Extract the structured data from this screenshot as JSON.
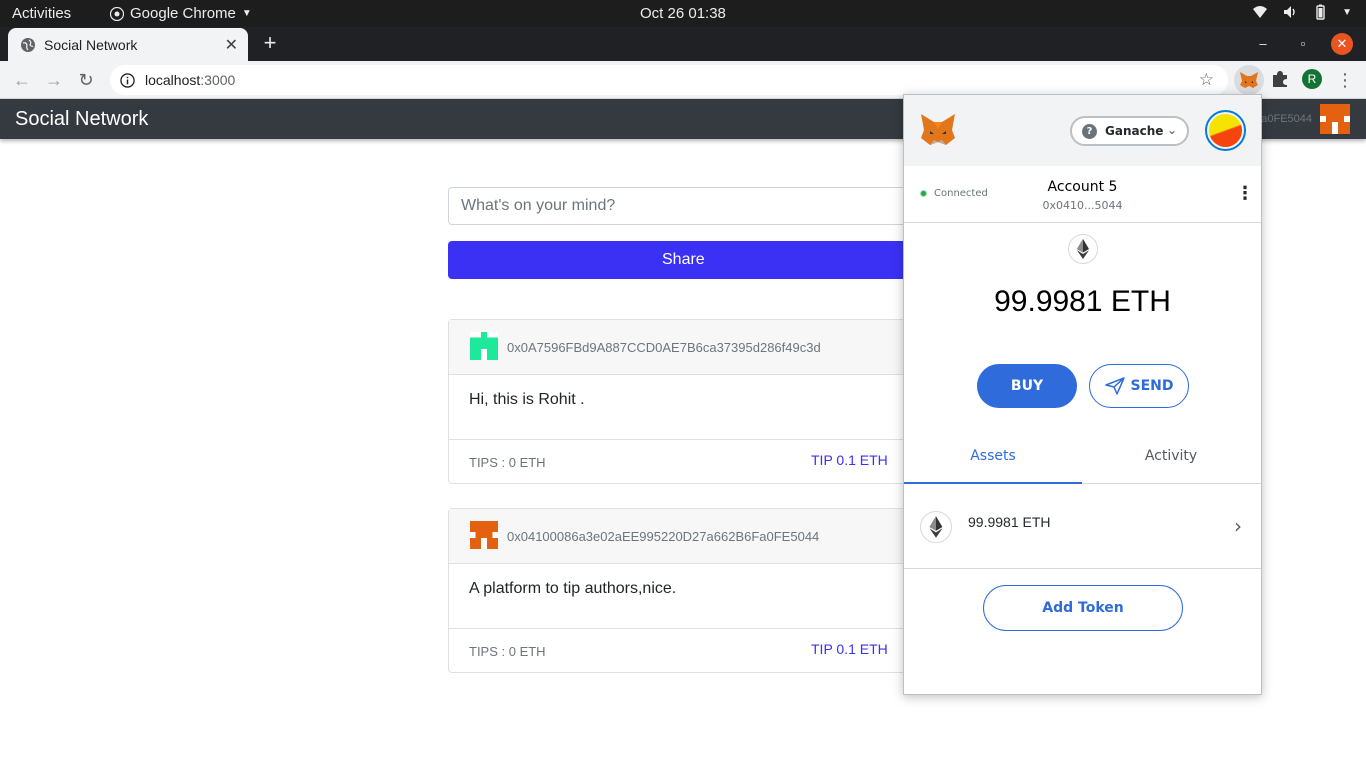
{
  "system_bar": {
    "activities": "Activities",
    "app_name": "Google Chrome",
    "clock": "Oct 26  01:38"
  },
  "browser": {
    "tab_title": "Social Network",
    "url_host": "localhost",
    "url_port": ":3000",
    "profile_initial": "R"
  },
  "app": {
    "brand": "Social Network",
    "nav_account": "Fa0FE5044",
    "post_placeholder": "What's on your mind?",
    "share_label": "Share",
    "posts": [
      {
        "author": "0x0A7596FBd9A887CCD0AE7B6ca37395d286f49c3d",
        "content": "Hi, this is Rohit .",
        "tips": "TIPS : 0 ETH",
        "tip_label": "TIP 0.1 ETH",
        "identicon_color": "#1ee89a"
      },
      {
        "author": "0x04100086a3e02aEE995220D27a662B6Fa0FE5044",
        "content": "A platform to tip authors,nice.",
        "tips": "TIPS : 0 ETH",
        "tip_label": "TIP 0.1 ETH",
        "identicon_color": "#e46110"
      }
    ]
  },
  "metamask": {
    "network": "Ganache",
    "status": "Connected",
    "account_name": "Account 5",
    "account_address": "0x0410...5044",
    "balance": "99.9981 ETH",
    "buy_label": "BUY",
    "send_label": "SEND",
    "tabs": {
      "assets": "Assets",
      "activity": "Activity"
    },
    "asset_balance": "99.9981 ETH",
    "add_token_label": "Add Token",
    "accent": "#2f6bdb"
  }
}
